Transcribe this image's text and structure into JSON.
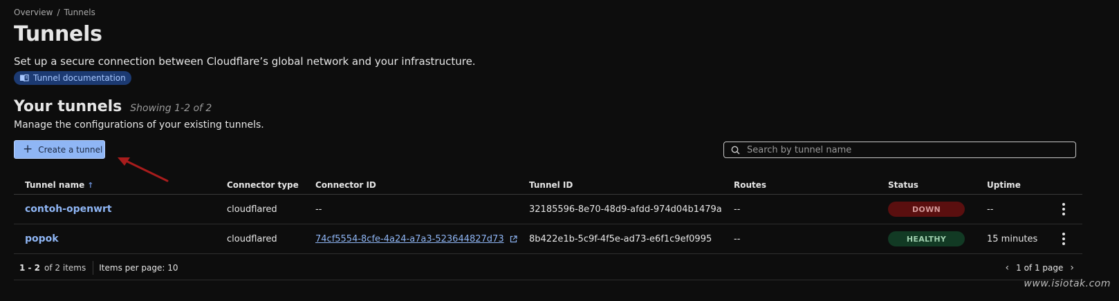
{
  "breadcrumb": {
    "items": [
      "Overview",
      "Tunnels"
    ],
    "separator": "/"
  },
  "page": {
    "title": "Tunnels",
    "description": "Set up a secure connection between Cloudflare’s global network and your infrastructure.",
    "doc_link": "Tunnel documentation"
  },
  "section": {
    "title": "Your tunnels",
    "showing": "Showing 1-2 of 2",
    "description": "Manage the configurations of your existing tunnels."
  },
  "actions": {
    "create_label": "Create a tunnel"
  },
  "search": {
    "placeholder": "Search by tunnel name",
    "value": ""
  },
  "table": {
    "columns": [
      "Tunnel name",
      "Connector type",
      "Connector ID",
      "Tunnel ID",
      "Routes",
      "Status",
      "Uptime"
    ],
    "rows": [
      {
        "name": "contoh-openwrt",
        "connector_type": "cloudflared",
        "connector_id": "--",
        "tunnel_id": "32185596-8e70-48d9-afdd-974d04b1479a",
        "routes": "--",
        "status": "DOWN",
        "uptime": "--"
      },
      {
        "name": "popok",
        "connector_type": "cloudflared",
        "connector_id": "74cf5554-8cfe-4a24-a7a3-523644827d73",
        "tunnel_id": "8b422e1b-5c9f-4f5e-ad73-e6f1c9ef0995",
        "routes": "--",
        "status": "HEALTHY",
        "uptime": "15 minutes"
      }
    ]
  },
  "pagination": {
    "range": "1 - 2",
    "total": "of 2 items",
    "per_page": "Items per page: 10",
    "page": "1 of 1 page"
  },
  "watermark": "www.isiotak.com",
  "colors": {
    "accent": "#8fb6f5",
    "down": "#5a0f0f",
    "healthy": "#123a24",
    "arrow": "#a81c1c"
  }
}
